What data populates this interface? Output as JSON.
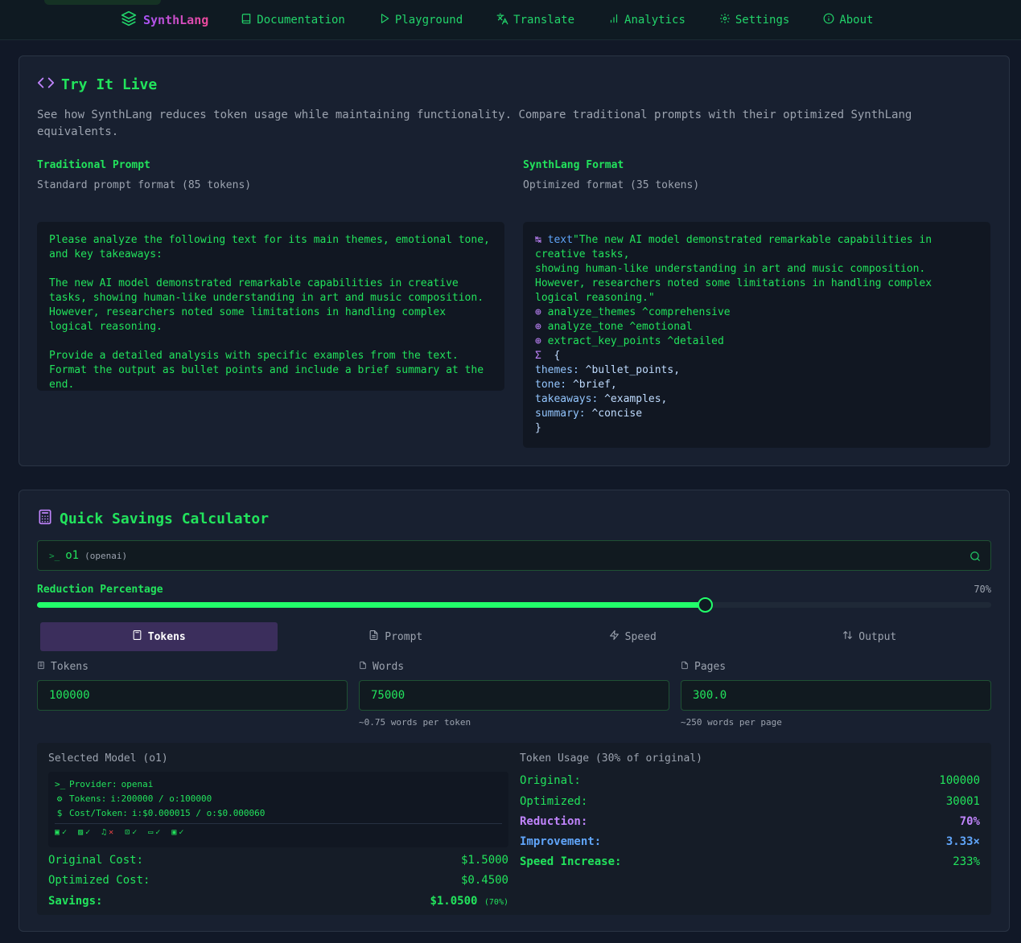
{
  "nav": {
    "brand": "SynthLang",
    "items": [
      {
        "label": "Documentation",
        "icon": "book-icon"
      },
      {
        "label": "Playground",
        "icon": "play-icon"
      },
      {
        "label": "Translate",
        "icon": "translate-icon"
      },
      {
        "label": "Analytics",
        "icon": "bar-chart-icon"
      },
      {
        "label": "Settings",
        "icon": "gear-icon"
      },
      {
        "label": "About",
        "icon": "info-icon"
      }
    ]
  },
  "live": {
    "title": "Try It Live",
    "intro": "See how SynthLang reduces token usage while maintaining functionality. Compare traditional prompts with their optimized SynthLang equivalents.",
    "traditional": {
      "heading": "Traditional Prompt",
      "sub": "Standard prompt format (85 tokens)",
      "p1": "Please analyze the following text for its main themes, emotional tone, and key takeaways:",
      "p2": "The new AI model demonstrated remarkable capabilities in creative tasks, showing human-like understanding in art and music composition. However, researchers noted some limitations in handling complex logical reasoning.",
      "p3": "Provide a detailed analysis with specific examples from the text. Format the output as bullet points and include a brief summary at the end."
    },
    "synthlang": {
      "heading": "SynthLang Format",
      "sub": "Optimized format (35 tokens)",
      "arrow": "↹",
      "text_kw": "text",
      "text_val": "\"The new AI model demonstrated remarkable capabilities in creative tasks,\nshowing human-like understanding in art and music composition. However, researchers noted some limitations in handling complex logical reasoning.\"",
      "op": "⊕",
      "ops": [
        "analyze_themes ^comprehensive",
        "analyze_tone ^emotional",
        "extract_key_points ^detailed"
      ],
      "sigma": "Σ",
      "open": "{",
      "fields": [
        {
          "key": "themes:",
          "val": " ^bullet_points,"
        },
        {
          "key": "tone:",
          "val": " ^brief,"
        },
        {
          "key": "takeaways:",
          "val": " ^examples,"
        },
        {
          "key": "summary:",
          "val": " ^concise"
        }
      ],
      "close": "}"
    }
  },
  "calc": {
    "title": "Quick Savings Calculator",
    "model": {
      "prompt": ">_",
      "name": "o1",
      "provider": "(openai)"
    },
    "reduction": {
      "label": "Reduction Percentage",
      "value_text": "70%",
      "value": 70
    },
    "tabs": [
      {
        "label": "Tokens",
        "icon": "calculator-icon",
        "active": true
      },
      {
        "label": "Prompt",
        "icon": "document-icon",
        "active": false
      },
      {
        "label": "Speed",
        "icon": "lightning-icon",
        "active": false
      },
      {
        "label": "Output",
        "icon": "sort-arrows-icon",
        "active": false
      }
    ],
    "fields": [
      {
        "label": "Tokens",
        "value": "100000",
        "hint": ""
      },
      {
        "label": "Words",
        "value": "75000",
        "hint": "~0.75 words per token"
      },
      {
        "label": "Pages",
        "value": "300.0",
        "hint": "~250 words per page"
      }
    ],
    "selected": {
      "title": "Selected Model (o1)",
      "provider_label": "Provider:",
      "provider": "openai",
      "tokens_label": "Tokens:",
      "tokens": "i:200000 / o:100000",
      "cost_label": "Cost/Token:",
      "cost": "i:$0.000015 / o:$0.000060",
      "caps": [
        {
          "icon": "text-icon",
          "ok": true
        },
        {
          "icon": "image-icon",
          "ok": true
        },
        {
          "icon": "audio-icon",
          "ok": false
        },
        {
          "icon": "robot-icon",
          "ok": true
        },
        {
          "icon": "chat-icon",
          "ok": true
        },
        {
          "icon": "function-icon",
          "ok": true
        }
      ],
      "original_label": "Original Cost:",
      "original": "$1.5000",
      "optimized_label": "Optimized Cost:",
      "optimized": "$0.4500",
      "savings_label": "Savings:",
      "savings": "$1.0500",
      "savings_pct": "(70%)"
    },
    "usage": {
      "title": "Token Usage (30% of original)",
      "rows": [
        {
          "k": "Original:",
          "v": "100000"
        },
        {
          "k": "Optimized:",
          "v": "30001"
        },
        {
          "k": "Reduction:",
          "v": "70%"
        },
        {
          "k": "Improvement:",
          "v": "3.33×"
        },
        {
          "k": "Speed Increase:",
          "v": "233%"
        }
      ]
    }
  }
}
